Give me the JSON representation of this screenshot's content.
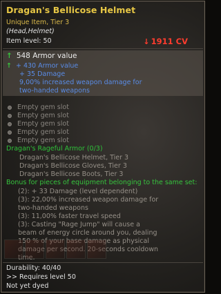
{
  "header": {
    "name": "Dragan's Bellicose Helmet",
    "quality": "Unique Item, Tier 3",
    "slots": "(Head,Helmet)",
    "item_level": "Item level: 50",
    "cv": "1911 CV"
  },
  "stats": {
    "armor": "548 Armor value",
    "bonus_armor": "+ 430  Armor value",
    "damage": "+ 35 Damage",
    "weapon_damage_1": "9,00% increased weapon damage for",
    "weapon_damage_2": "two-handed weapons"
  },
  "gems": [
    "Empty gem slot",
    "Empty gem slot",
    "Empty gem slot",
    "Empty gem slot",
    "Empty gem slot"
  ],
  "set": {
    "name": "Dragan's Rageful Armor (0/3)",
    "items": [
      "Dragan's Bellicose Helmet, Tier 3",
      "Dragan's Bellicose Gloves, Tier 3",
      "Dragan's Bellicose Boots, Tier 3"
    ],
    "bonus_header": "Bonus for pieces of equipment belonging to the same set:",
    "bonus_lines": [
      "(2): + 33 Damage (level dependent)",
      "(3): 22,00% increased weapon damage for",
      "two-handed weapons",
      "(3): 11,00% faster travel speed",
      "(3): Casting \"Rage Jump\" will cause a",
      "beam of energy circle around you, dealing",
      "150 % of your base damage as physical",
      "damage per second. 20-seconds cooldown",
      "time."
    ]
  },
  "footer": {
    "durability": "Durability: 40/40",
    "requires": ">> Requires level 50",
    "dyed": "Not yet dyed"
  },
  "icons": {
    "stat_up": "green-up-arrow",
    "cv_down": "red-down-arrow",
    "gem": "gem-slot-dot"
  },
  "colors": {
    "title": "#e6c645",
    "set_green": "#2fc23a",
    "cv_red": "#ff3c2e",
    "magic_blue": "#5a8ce6"
  }
}
